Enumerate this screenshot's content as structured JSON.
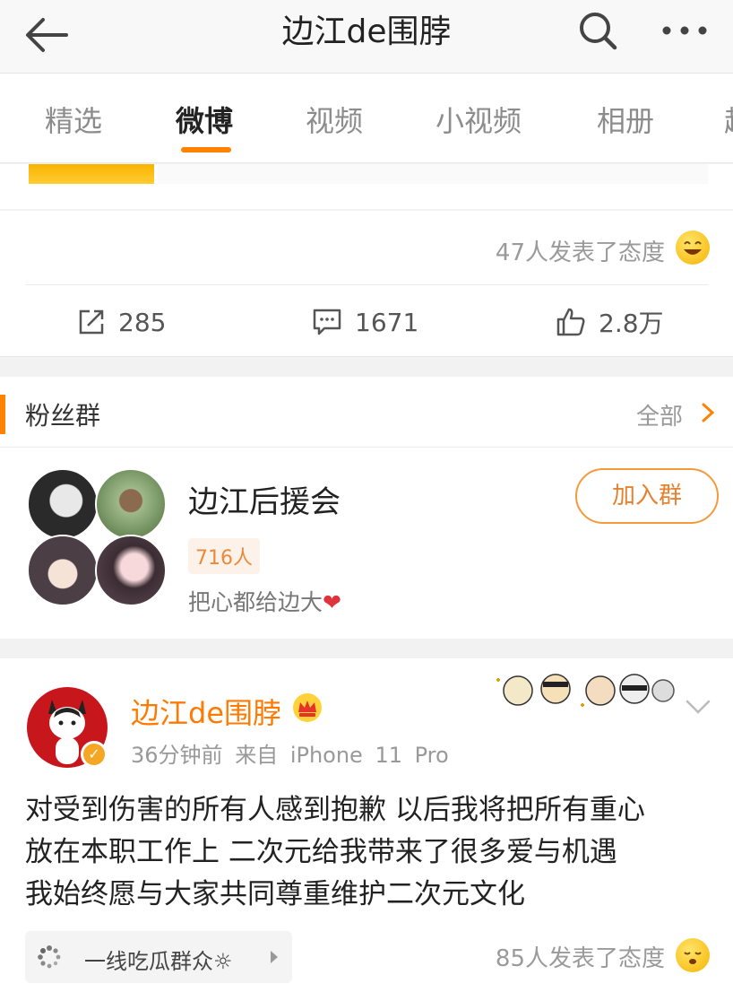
{
  "header": {
    "title": "边江de围脖"
  },
  "tabs": [
    {
      "label": "精选"
    },
    {
      "label": "微博"
    },
    {
      "label": "视频"
    },
    {
      "label": "小视频"
    },
    {
      "label": "相册"
    },
    {
      "label": "超"
    }
  ],
  "post1": {
    "reactions": "47人发表了态度",
    "actions": {
      "repost": "285",
      "comment": "1671",
      "like": "2.8万"
    }
  },
  "fans": {
    "title": "粉丝群",
    "all": "全部",
    "group_name": "边江后援会",
    "count": "716人",
    "desc": "把心都给边大",
    "heart": "❤",
    "join": "加入群"
  },
  "post2": {
    "author": "边江de围脖",
    "time": "36分钟前",
    "source": "来自 iPhone 11 Pro",
    "lines": [
      "对受到伤害的所有人感到抱歉 以后我将把所有重心",
      "放在本职工作上 二次元给我带来了很多爱与机遇",
      "我始终愿与大家共同尊重维护二次元文化"
    ],
    "topic": "一线吃瓜群众☼",
    "reactions": "85人发表了态度"
  },
  "colors": {
    "accent": "#ff8200",
    "author": "#ff7a00",
    "verified": "#f5a623"
  }
}
